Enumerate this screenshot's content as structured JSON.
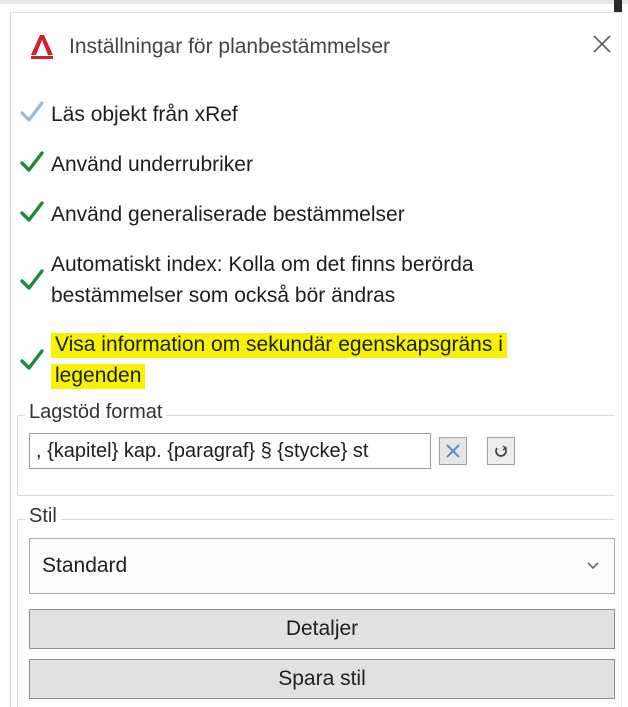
{
  "dialog": {
    "title": "Inställningar för planbestämmelser",
    "app_icon": "autocad-logo-icon",
    "close_icon": "close-icon"
  },
  "options": [
    {
      "label": "Läs objekt från xRef",
      "checked": true,
      "check_color": "#9fb6d4"
    },
    {
      "label": "Använd underrubriker",
      "checked": true,
      "check_color": "#1f8a3a"
    },
    {
      "label": "Använd generaliserade bestämmelser",
      "checked": true,
      "check_color": "#1f8a3a"
    },
    {
      "label_line1": "Automatiskt index: Kolla om det finns berörda",
      "label_line2": "bestämmelser som också bör ändras",
      "checked": true,
      "check_color": "#1f8a3a"
    },
    {
      "label_line1": "Visa information om sekundär egenskapsgräns i",
      "label_line2": "legenden",
      "checked": true,
      "check_color": "#1f8a3a",
      "highlight_color": "#f6f200"
    }
  ],
  "lagstod": {
    "group_label": "Lagstöd format",
    "value": ",  {kapitel} kap. {paragraf} § {stycke} st",
    "clear_icon": "clear-x-icon",
    "reset_icon": "refresh-icon"
  },
  "stil": {
    "group_label": "Stil",
    "selected": "Standard",
    "dropdown_icon": "chevron-down-icon",
    "details_label": "Detaljer",
    "save_label": "Spara stil"
  }
}
